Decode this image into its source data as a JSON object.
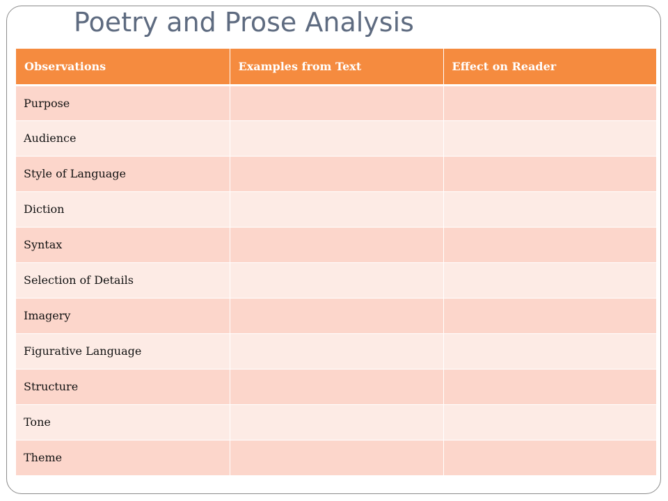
{
  "slide": {
    "title": "Poetry and Prose Analysis"
  },
  "table": {
    "headers": [
      "Observations",
      "Examples from Text",
      "Effect on Reader"
    ],
    "rows": [
      [
        "Purpose",
        "",
        ""
      ],
      [
        "Audience",
        "",
        ""
      ],
      [
        "Style of Language",
        "",
        ""
      ],
      [
        "Diction",
        "",
        ""
      ],
      [
        "Syntax",
        "",
        ""
      ],
      [
        "Selection of Details",
        "",
        ""
      ],
      [
        "Imagery",
        "",
        ""
      ],
      [
        "Figurative Language",
        "",
        ""
      ],
      [
        "Structure",
        "",
        ""
      ],
      [
        "Tone",
        "",
        ""
      ],
      [
        "Theme",
        "",
        ""
      ]
    ]
  },
  "colors": {
    "header_bg": "#f58b3f",
    "row_dark": "#fcd6cb",
    "row_light": "#fdebe5",
    "title": "#5e6b80"
  }
}
